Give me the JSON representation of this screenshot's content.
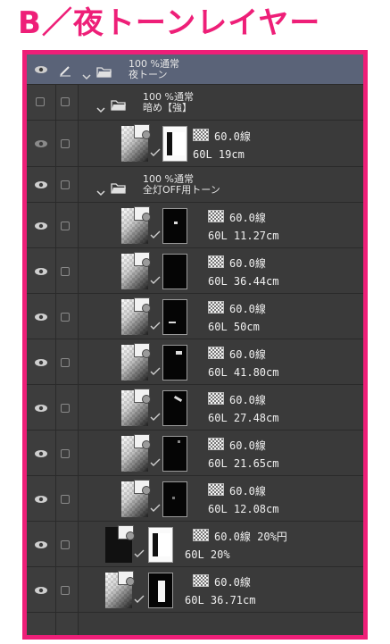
{
  "title": "B／夜トーンレイヤー",
  "colors": {
    "title": "#ee1f78",
    "frame_border": "#ee1f78",
    "panel_bg": "#3a3a3a",
    "selected_row": "#5a6378"
  },
  "folders": [
    {
      "line1": "100 %通常",
      "line2": "夜トーン"
    },
    {
      "line1": "100 %通常",
      "line2": "暗め【強】"
    },
    {
      "line1": "100 %通常",
      "line2": "全灯OFF用トーン"
    }
  ],
  "layers": [
    {
      "tone": "60.0線",
      "info": "60L 19cm"
    },
    {
      "tone": "60.0線",
      "info": "60L 11.27cm"
    },
    {
      "tone": "60.0線",
      "info": "60L 36.44cm"
    },
    {
      "tone": "60.0線",
      "info": "60L 50cm"
    },
    {
      "tone": "60.0線",
      "info": "60L 41.80cm"
    },
    {
      "tone": "60.0線",
      "info": "60L 27.48cm"
    },
    {
      "tone": "60.0線",
      "info": "60L 21.65cm"
    },
    {
      "tone": "60.0線",
      "info": "60L 12.08cm"
    },
    {
      "tone": "60.0線 20%円",
      "info": "60L 20%"
    },
    {
      "tone": "60.0線",
      "info": "60L 36.71cm"
    }
  ],
  "icons": [
    "eye-icon",
    "pen-icon",
    "lock-checkbox",
    "folder-icon",
    "caret-down-icon",
    "tone-pattern-icon",
    "checkmark-icon"
  ]
}
